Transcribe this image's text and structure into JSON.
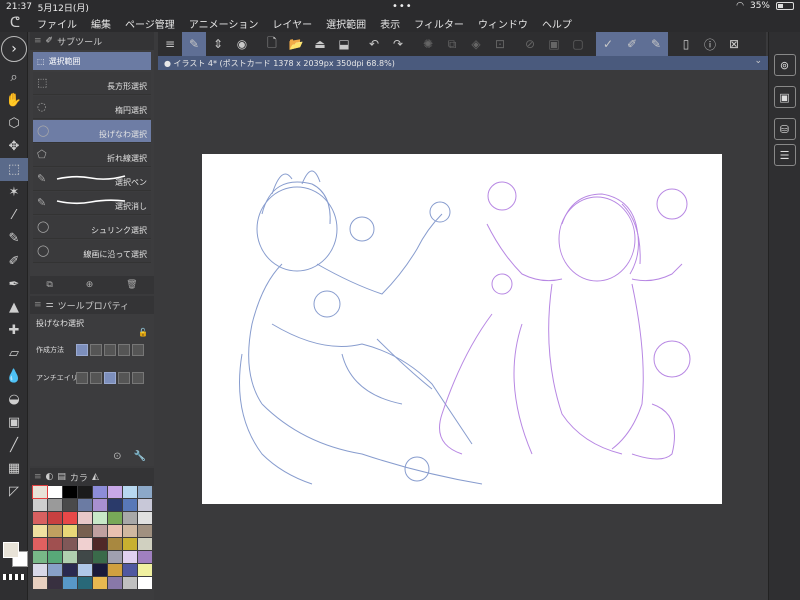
{
  "status": {
    "time": "21:37",
    "date": "5月12日(月)",
    "battery": "35%",
    "battery_fraction": 0.35
  },
  "menu": [
    "ファイル",
    "編集",
    "ページ管理",
    "アニメーション",
    "レイヤー",
    "選択範囲",
    "表示",
    "フィルター",
    "ウィンドウ",
    "ヘルプ"
  ],
  "subtool": {
    "panel_title": "サブツール",
    "group": "選択範囲",
    "items": [
      "長方形選択",
      "楕円選択",
      "投げなわ選択",
      "折れ線選択",
      "選択ペン",
      "選択消し",
      "シュリンク選択",
      "線画に沿って選択"
    ],
    "active_index": 2
  },
  "property": {
    "panel_title": "ツールプロパティ",
    "tool_name": "投げなわ選択",
    "rows": [
      "作成方法",
      "アンチエイリ"
    ]
  },
  "color_panel": {
    "tab_label": "カラ"
  },
  "canvas": {
    "tab_label": "● イラスト 4* (ポストカード 1378 x 2039px 350dpi 68.8%)"
  },
  "colors": {
    "accent": "#6b7ba3",
    "sketch_blue": "#7b92c9",
    "sketch_purple": "#b07be0",
    "palette": [
      "#e8e3d8",
      "#ffffff",
      "#000000",
      "#1b1b1b",
      "#8c8cd9",
      "#c8a8e8",
      "#b8d8f0",
      "#8ca8c8",
      "#cfcfcf",
      "#9a9a9a",
      "#4a4a4a",
      "#6b7ba3",
      "#a890d0",
      "#2a3a6a",
      "#5878b8",
      "#c8c8d8",
      "#d86060",
      "#c84040",
      "#e84848",
      "#e8c8c8",
      "#c8e8c8",
      "#78a858",
      "#a8a8a8",
      "#e0e0e0",
      "#f0e0a0",
      "#c0a060",
      "#e8d878",
      "#786050",
      "#c0a0a0",
      "#e8c0b0",
      "#d0b8a0",
      "#a09080",
      "#e06060",
      "#a05050",
      "#805858",
      "#f0d0d0",
      "#502828",
      "#a88840",
      "#c8b030",
      "#d0d0c0",
      "#78b888",
      "#58a878",
      "#b0d0b0",
      "#404848",
      "#3a6a4a",
      "#a0a0b0",
      "#e0d0f0",
      "#a080c0",
      "#d8d8e8",
      "#88a0c8",
      "#2a2a50",
      "#b0c8e8",
      "#1a1a3a",
      "#d0a040",
      "#5058a0",
      "#f0f0a0",
      "#e8d0c0",
      "#383040",
      "#5898c8",
      "#286878",
      "#e8b850",
      "#8878a8",
      "#c0c0c0",
      "#ffffff"
    ]
  }
}
